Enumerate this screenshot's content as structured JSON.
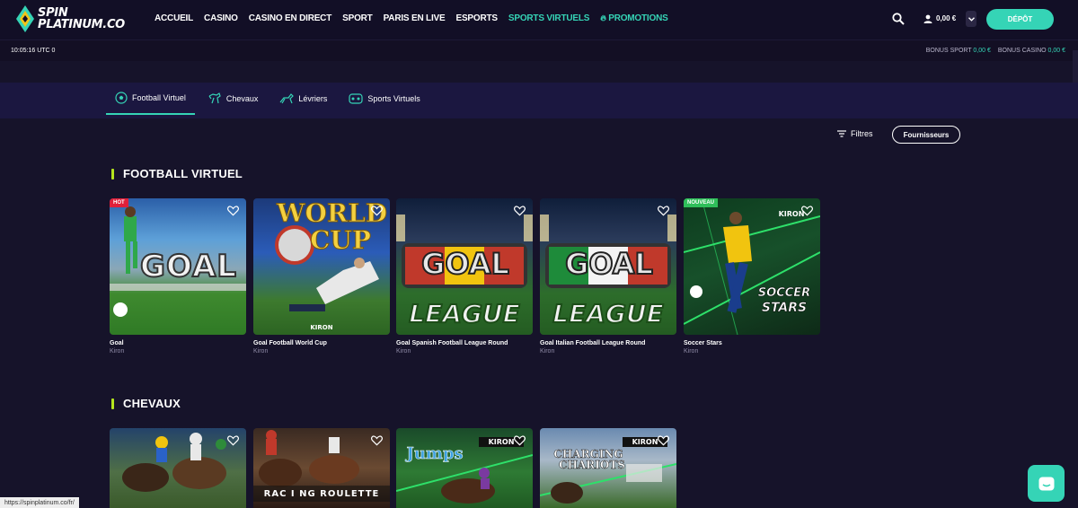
{
  "brand": {
    "line1": "SPIN",
    "line2": "PLATINUM.CO"
  },
  "nav": [
    {
      "label": "ACCUEIL"
    },
    {
      "label": "CASINO"
    },
    {
      "label": "CASINO EN DIRECT"
    },
    {
      "label": "SPORT"
    },
    {
      "label": "PARIS EN LIVE"
    },
    {
      "label": "ESPORTS"
    },
    {
      "label": "SPORTS VIRTUELS"
    },
    {
      "label": "PROMOTIONS"
    }
  ],
  "header": {
    "balance": "0,00 €",
    "deposit_label": "DÉPÔT"
  },
  "subbar": {
    "clock": "10:05:16 UTC 0",
    "bonus_sport_label": "BONUS SPORT",
    "bonus_sport_value": "0,00 €",
    "bonus_casino_label": "BONUS CASINO",
    "bonus_casino_value": "0,00 €"
  },
  "tabs": [
    {
      "label": "Football Virtuel"
    },
    {
      "label": "Chevaux"
    },
    {
      "label": "Lévriers"
    },
    {
      "label": "Sports Virtuels"
    }
  ],
  "filters": {
    "filters_label": "Filtres",
    "providers_label": "Fournisseurs"
  },
  "sections": [
    {
      "title": "FOOTBALL VIRTUEL",
      "games": [
        {
          "name": "Goal",
          "provider": "Kiron",
          "badge": "HOT",
          "art": "GOAL"
        },
        {
          "name": "Goal Football World Cup",
          "provider": "Kiron",
          "badge": "",
          "art": "WORLD CUP"
        },
        {
          "name": "Goal Spanish Football League Round",
          "provider": "Kiron",
          "badge": "",
          "art": "GOAL LEAGUE"
        },
        {
          "name": "Goal Italian Football League Round",
          "provider": "Kiron",
          "badge": "",
          "art": "GOAL LEAGUE"
        },
        {
          "name": "Soccer Stars",
          "provider": "Kiron",
          "badge": "NOUVEAU",
          "art": "SOCCER STARS"
        }
      ]
    },
    {
      "title": "CHEVAUX",
      "games": [
        {
          "art": ""
        },
        {
          "art": "RACING ROULETTE"
        },
        {
          "art": "Jumps"
        },
        {
          "art": "CHARGING CHARIOTS"
        }
      ]
    }
  ],
  "art_text": {
    "goal": "GOAL",
    "world": "WORLD",
    "cup": "CUP",
    "league": "LEAGUE",
    "soccer": "SOCCER",
    "stars": "STARS",
    "kiron": "KIRON",
    "racing_roulette": "RAC I NG ROULETTE",
    "jumps": "Jumps",
    "charging": "CHARGING",
    "chariots": "CHARIOTS"
  },
  "status_url": "https://spinplatinum.co/fr/",
  "colors": {
    "accent": "#35d4b6",
    "section_bar": "#b5e51d",
    "hot": "#e0203a",
    "new": "#2fbf5a"
  }
}
